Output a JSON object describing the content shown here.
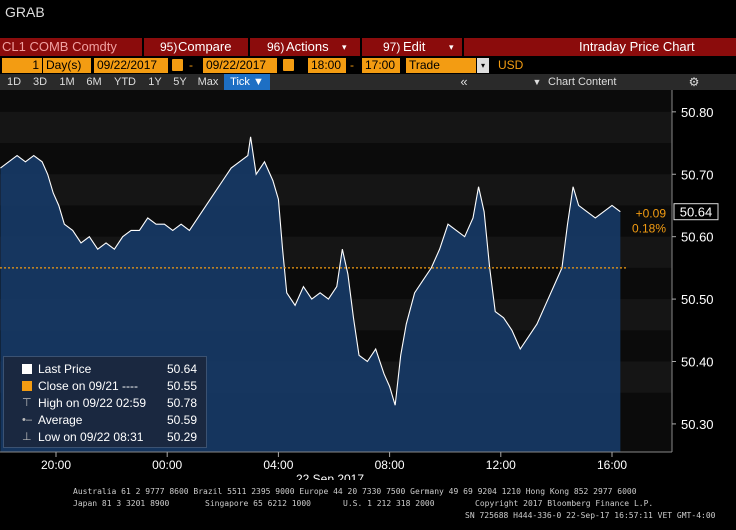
{
  "window": {
    "title": "GRAB"
  },
  "toolbar": {
    "ticker": "CL1 COMB Comdty",
    "compare_num": "95)",
    "compare_label": "Compare",
    "actions_num": "96)",
    "actions_label": "Actions",
    "edit_num": "97)",
    "edit_label": "Edit",
    "chart_title": "Intraday Price Chart"
  },
  "settings": {
    "days_value": "1",
    "days_unit": "Day(s)",
    "start_date": "09/22/2017",
    "end_date": "09/22/2017",
    "date_sep": "-",
    "start_time": "18:00",
    "time_sep": "-",
    "end_time": "17:00",
    "market_field": "Trade",
    "currency": "USD"
  },
  "periods": {
    "buttons": [
      "1D",
      "3D",
      "1M",
      "6M",
      "YTD",
      "1Y",
      "5Y",
      "Max"
    ],
    "tick_label": "Tick ▼",
    "chart_content_label": "Chart Content",
    "collapse_glyph": "«",
    "gear_glyph": "⚙"
  },
  "legend": {
    "items": [
      {
        "label": "Last Price",
        "value": "50.64",
        "icon": "white-square"
      },
      {
        "label": "Close on 09/21 ----",
        "value": "50.55",
        "icon": "orange-square"
      },
      {
        "label": "High on 09/22 02:59",
        "value": "50.78",
        "icon": "high-marker-icon"
      },
      {
        "label": "Average",
        "value": "50.59",
        "icon": "average-marker-icon"
      },
      {
        "label": "Low on 09/22 08:31",
        "value": "50.29",
        "icon": "low-marker-icon"
      }
    ]
  },
  "chart_data": {
    "type": "area",
    "title": "",
    "xlabel": "22 Sep 2017",
    "ylabel": "",
    "x_ticks": [
      "20:00",
      "00:00",
      "04:00",
      "08:00",
      "12:00",
      "16:00"
    ],
    "y_ticks": [
      "50.80",
      "50.70",
      "50.60",
      "50.50",
      "50.40",
      "50.30"
    ],
    "ylim": [
      50.255,
      50.835
    ],
    "xlim_hours": [
      18,
      41
    ],
    "prev_close": 50.55,
    "last_price": "50.64",
    "change": "+0.09",
    "change_pct": "0.18%",
    "grid": true,
    "series": [
      {
        "name": "Last Price",
        "points": [
          [
            18.0,
            50.71
          ],
          [
            18.3,
            50.72
          ],
          [
            18.6,
            50.73
          ],
          [
            18.9,
            50.72
          ],
          [
            19.2,
            50.73
          ],
          [
            19.5,
            50.72
          ],
          [
            19.7,
            50.7
          ],
          [
            19.9,
            50.67
          ],
          [
            20.1,
            50.65
          ],
          [
            20.3,
            50.62
          ],
          [
            20.6,
            50.61
          ],
          [
            20.9,
            50.59
          ],
          [
            21.2,
            50.6
          ],
          [
            21.5,
            50.58
          ],
          [
            21.8,
            50.59
          ],
          [
            22.1,
            50.58
          ],
          [
            22.4,
            50.6
          ],
          [
            22.7,
            50.61
          ],
          [
            23.0,
            50.61
          ],
          [
            23.3,
            50.63
          ],
          [
            23.6,
            50.62
          ],
          [
            23.9,
            50.62
          ],
          [
            24.2,
            50.61
          ],
          [
            24.5,
            50.62
          ],
          [
            24.8,
            50.61
          ],
          [
            25.1,
            50.63
          ],
          [
            25.4,
            50.65
          ],
          [
            25.7,
            50.67
          ],
          [
            26.0,
            50.69
          ],
          [
            26.3,
            50.71
          ],
          [
            26.6,
            50.72
          ],
          [
            26.9,
            50.73
          ],
          [
            27.0,
            50.76
          ],
          [
            27.2,
            50.7
          ],
          [
            27.5,
            50.72
          ],
          [
            27.8,
            50.69
          ],
          [
            28.0,
            50.66
          ],
          [
            28.15,
            50.58
          ],
          [
            28.3,
            50.51
          ],
          [
            28.6,
            50.49
          ],
          [
            28.9,
            50.52
          ],
          [
            29.2,
            50.5
          ],
          [
            29.5,
            50.51
          ],
          [
            29.8,
            50.5
          ],
          [
            30.1,
            50.52
          ],
          [
            30.3,
            50.58
          ],
          [
            30.5,
            50.54
          ],
          [
            30.7,
            50.47
          ],
          [
            30.9,
            50.41
          ],
          [
            31.2,
            50.4
          ],
          [
            31.5,
            50.42
          ],
          [
            31.8,
            50.38
          ],
          [
            32.0,
            50.36
          ],
          [
            32.2,
            50.33
          ],
          [
            32.4,
            50.41
          ],
          [
            32.6,
            50.46
          ],
          [
            32.9,
            50.51
          ],
          [
            33.2,
            50.53
          ],
          [
            33.5,
            50.55
          ],
          [
            33.8,
            50.58
          ],
          [
            34.1,
            50.62
          ],
          [
            34.4,
            50.61
          ],
          [
            34.7,
            50.6
          ],
          [
            35.0,
            50.63
          ],
          [
            35.2,
            50.68
          ],
          [
            35.4,
            50.64
          ],
          [
            35.6,
            50.55
          ],
          [
            35.8,
            50.48
          ],
          [
            36.1,
            50.47
          ],
          [
            36.4,
            50.45
          ],
          [
            36.7,
            50.42
          ],
          [
            37.0,
            50.44
          ],
          [
            37.3,
            50.46
          ],
          [
            37.6,
            50.49
          ],
          [
            37.9,
            50.52
          ],
          [
            38.2,
            50.55
          ],
          [
            38.4,
            50.62
          ],
          [
            38.6,
            50.68
          ],
          [
            38.8,
            50.65
          ],
          [
            39.1,
            50.64
          ],
          [
            39.4,
            50.63
          ],
          [
            39.7,
            50.64
          ],
          [
            40.0,
            50.65
          ],
          [
            40.3,
            50.64
          ]
        ]
      }
    ]
  },
  "footer": {
    "line1": "Australia 61 2 9777 8600 Brazil 5511 2395 9000 Europe 44 20 7330 7500 Germany 49 69 9204 1210 Hong Kong 852 2977 6000",
    "line2a": "Japan 81 3 3201 8900",
    "line2b": "Singapore 65 6212 1000",
    "line2c": "U.S. 1 212 318 2000",
    "line2d": "Copyright 2017 Bloomberg Finance L.P.",
    "line3": "SN 725688 H444-336-0 22-Sep-17 16:57:11 VET  GMT-4:00"
  }
}
